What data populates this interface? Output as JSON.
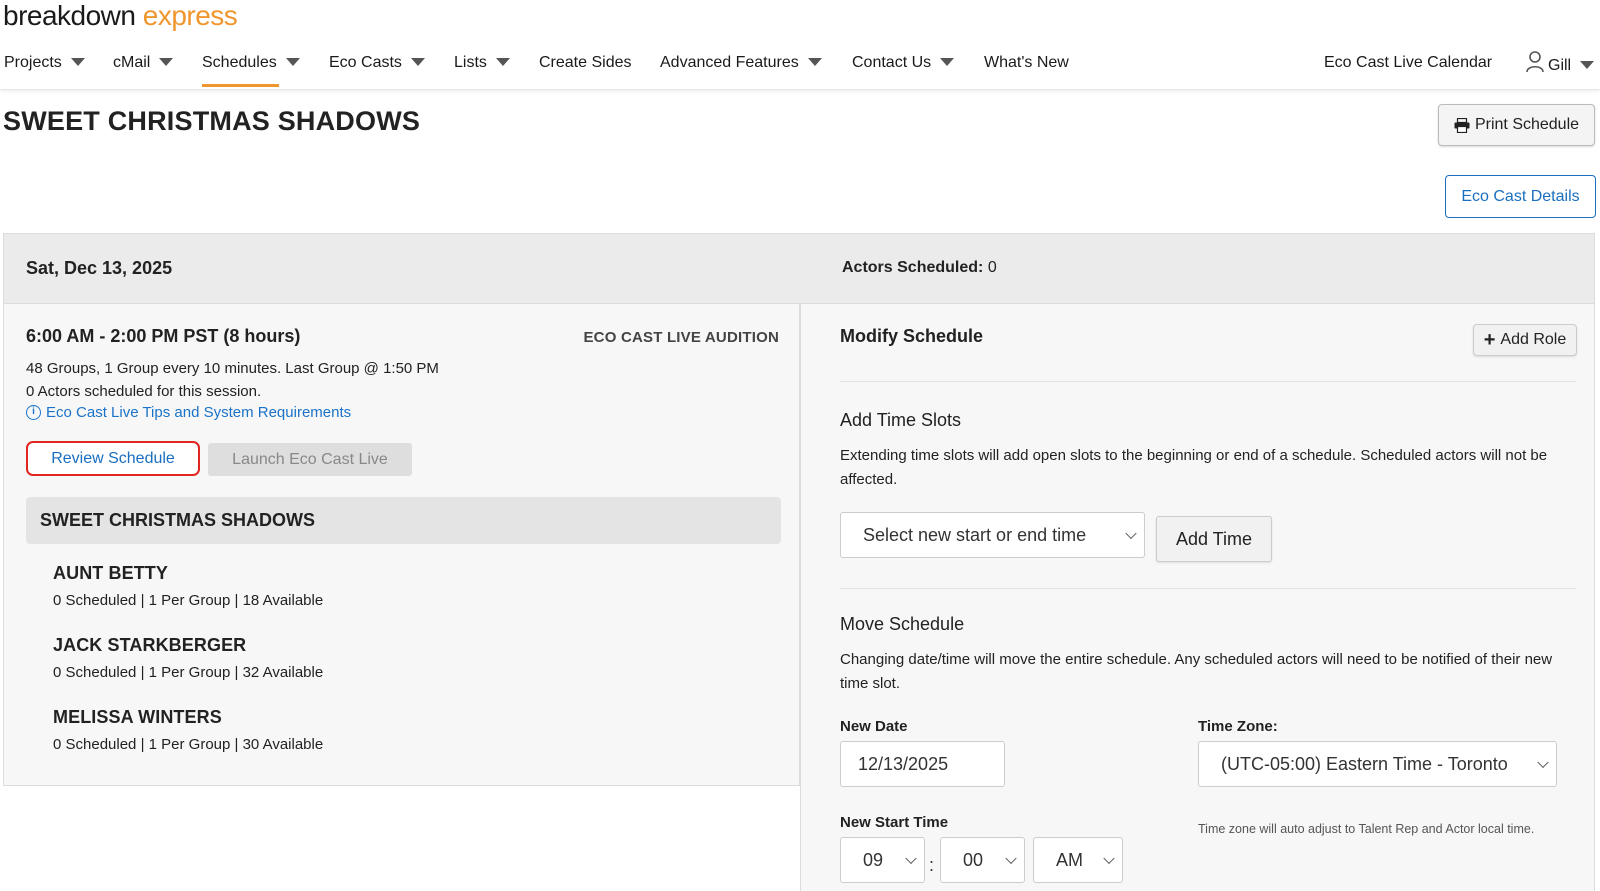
{
  "logo": {
    "part1": "breakdown",
    "part2": "express"
  },
  "nav": {
    "projects": "Projects",
    "cmail": "cMail",
    "schedules": "Schedules",
    "eco_casts": "Eco Casts",
    "lists": "Lists",
    "create_sides": "Create Sides",
    "advanced_features": "Advanced Features",
    "contact_us": "Contact Us",
    "whats_new": "What's New",
    "eco_calendar": "Eco Cast Live Calendar",
    "user": "Gill",
    "active": "Schedules"
  },
  "page": {
    "title": "SWEET CHRISTMAS SHADOWS",
    "print_label": "Print Schedule",
    "eco_details_label": "Eco Cast Details"
  },
  "schedule": {
    "date": "Sat, Dec 13, 2025",
    "actors_scheduled_label": "Actors Scheduled:",
    "actors_scheduled_value": "0",
    "session_time": "6:00 AM - 2:00 PM PST (8 hours)",
    "session_type": "ECO CAST LIVE AUDITION",
    "groups_line": "48 Groups, 1 Group every 10 minutes. Last Group @ 1:50 PM",
    "actors_line": "0 Actors scheduled for this session.",
    "tips_link": "Eco Cast Live Tips and System Requirements",
    "review_label": "Review Schedule",
    "launch_label": "Launch Eco Cast Live",
    "project_name": "SWEET CHRISTMAS SHADOWS",
    "roles": [
      {
        "name": "AUNT BETTY",
        "stats": "0 Scheduled | 1 Per Group | 18 Available"
      },
      {
        "name": "JACK STARKBERGER",
        "stats": "0 Scheduled | 1 Per Group | 32 Available"
      },
      {
        "name": "MELISSA WINTERS",
        "stats": "0 Scheduled | 1 Per Group | 30 Available"
      }
    ]
  },
  "modify": {
    "title": "Modify Schedule",
    "add_role_label": "Add Role",
    "add_time_slots": {
      "title": "Add Time Slots",
      "desc": "Extending time slots will add open slots to the beginning or end of a schedule. Scheduled actors will not be affected.",
      "select_placeholder": "Select new start or end time",
      "button": "Add Time"
    },
    "move_schedule": {
      "title": "Move Schedule",
      "desc": "Changing date/time will move the entire schedule. Any scheduled actors will need to be notified of their new time slot.",
      "new_date_label": "New Date",
      "new_date_value": "12/13/2025",
      "time_zone_label": "Time Zone:",
      "time_zone_value": "(UTC-05:00) Eastern Time - Toronto",
      "time_zone_note": "Time zone will auto adjust to Talent Rep and Actor local time.",
      "new_start_time_label": "New Start Time",
      "hour": "09",
      "minute": "00",
      "ampm": "AM"
    }
  },
  "colors": {
    "accent_orange": "#f0962e",
    "link_blue": "#1a73c8",
    "highlight_red": "#e0261f"
  }
}
